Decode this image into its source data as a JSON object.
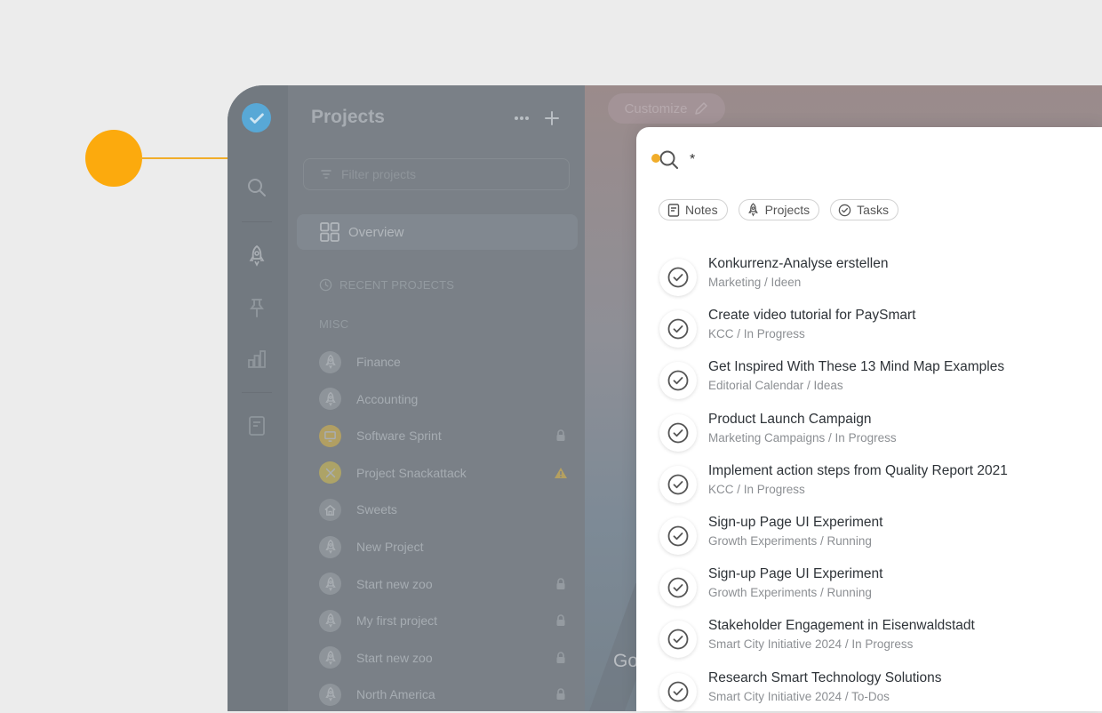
{
  "sidebar": {
    "items": [
      {
        "name": "search-icon"
      },
      {
        "name": "rocket-icon"
      },
      {
        "name": "pin-icon"
      },
      {
        "name": "chart-icon"
      },
      {
        "name": "notes-icon"
      }
    ]
  },
  "projects": {
    "title": "Projects",
    "filter_placeholder": "Filter projects",
    "overview_label": "Overview",
    "recent_label": "RECENT PROJECTS",
    "misc_label": "MISC",
    "items": [
      {
        "label": "Finance",
        "icon": "rocket-icon",
        "status": ""
      },
      {
        "label": "Accounting",
        "icon": "rocket-icon",
        "status": ""
      },
      {
        "label": "Software Sprint",
        "icon": "monitor-icon",
        "status": "lock-icon"
      },
      {
        "label": "Project Snackattack",
        "icon": "cross-icon",
        "status": "warning-icon"
      },
      {
        "label": "Sweets",
        "icon": "home-icon",
        "status": ""
      },
      {
        "label": "New Project",
        "icon": "rocket-icon",
        "status": ""
      },
      {
        "label": "Start new zoo",
        "icon": "rocket-icon",
        "status": "lock-icon"
      },
      {
        "label": "My first project",
        "icon": "rocket-icon",
        "status": "lock-icon"
      },
      {
        "label": "Start new zoo",
        "icon": "rocket-icon",
        "status": "lock-icon"
      },
      {
        "label": "North America",
        "icon": "rocket-icon",
        "status": "lock-icon"
      }
    ]
  },
  "background": {
    "customize_label": "Customize",
    "partial_text": "Go"
  },
  "search": {
    "query": "*",
    "filters": [
      {
        "label": "Notes",
        "icon": "note-icon"
      },
      {
        "label": "Projects",
        "icon": "rocket-icon"
      },
      {
        "label": "Tasks",
        "icon": "check-circle-icon"
      }
    ],
    "results": [
      {
        "title": "Konkurrenz-Analyse erstellen",
        "path": "Marketing / Ideen"
      },
      {
        "title": "Create video tutorial for PaySmart",
        "path": "KCC / In Progress"
      },
      {
        "title": "Get Inspired With These 13 Mind Map Examples",
        "path": "Editorial Calendar / Ideas"
      },
      {
        "title": "Product Launch Campaign",
        "path": "Marketing Campaigns / In Progress"
      },
      {
        "title": "Implement action steps from Quality Report 2021",
        "path": "KCC / In Progress"
      },
      {
        "title": "Sign-up Page UI Experiment",
        "path": "Growth Experiments / Running"
      },
      {
        "title": "Sign-up Page UI Experiment",
        "path": "Growth Experiments / Running"
      },
      {
        "title": "Stakeholder Engagement in Eisenwaldstadt",
        "path": "Smart City Initiative 2024 / In Progress"
      },
      {
        "title": "Research Smart Technology Solutions",
        "path": "Smart City Initiative 2024 / To-Dos"
      }
    ]
  },
  "colors": {
    "accent": "#fcaa0d",
    "logo": "#58a8d6",
    "overlay": "#777d84"
  }
}
